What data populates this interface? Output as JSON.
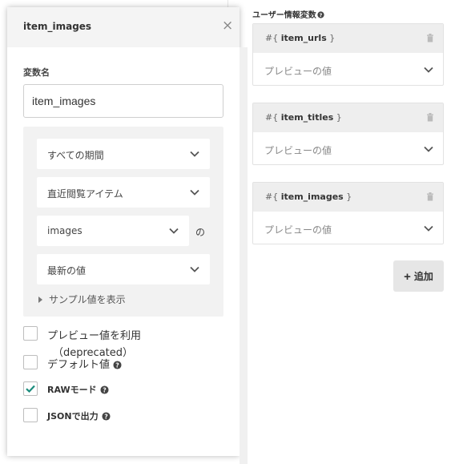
{
  "editor": {
    "title": "item_images",
    "close_icon": "close-icon",
    "varname_label": "変数名",
    "varname_value": "item_images",
    "selects": {
      "period": "すべての期間",
      "source": "直近閲覧アイテム",
      "field": "images",
      "aggregation": "最新の値"
    },
    "no_label": "の",
    "sample_toggle": "サンプル値を表示",
    "checkboxes": [
      {
        "label": "プレビュー値を利用",
        "sub": "（deprecated）",
        "checked": false
      },
      {
        "label": "デフォルト値",
        "checked": false
      },
      {
        "label": "RAWモード",
        "checked": true
      },
      {
        "label": "JSONで出力",
        "checked": false
      }
    ]
  },
  "user_vars": {
    "title": "ユーザー情報変数",
    "items": [
      {
        "prefix": "#{",
        "name": "item_urls",
        "suffix": "}",
        "preview": "プレビューの値"
      },
      {
        "prefix": "#{",
        "name": "item_titles",
        "suffix": "}",
        "preview": "プレビューの値"
      },
      {
        "prefix": "#{",
        "name": "item_images",
        "suffix": "}",
        "preview": "プレビューの値"
      }
    ],
    "add_label": "追加",
    "add_icon": "plus-icon"
  },
  "colors": {
    "accent_check": "#1a8c7c",
    "header_bg": "#f4f4f4",
    "card_head_bg": "#eeeeee"
  }
}
